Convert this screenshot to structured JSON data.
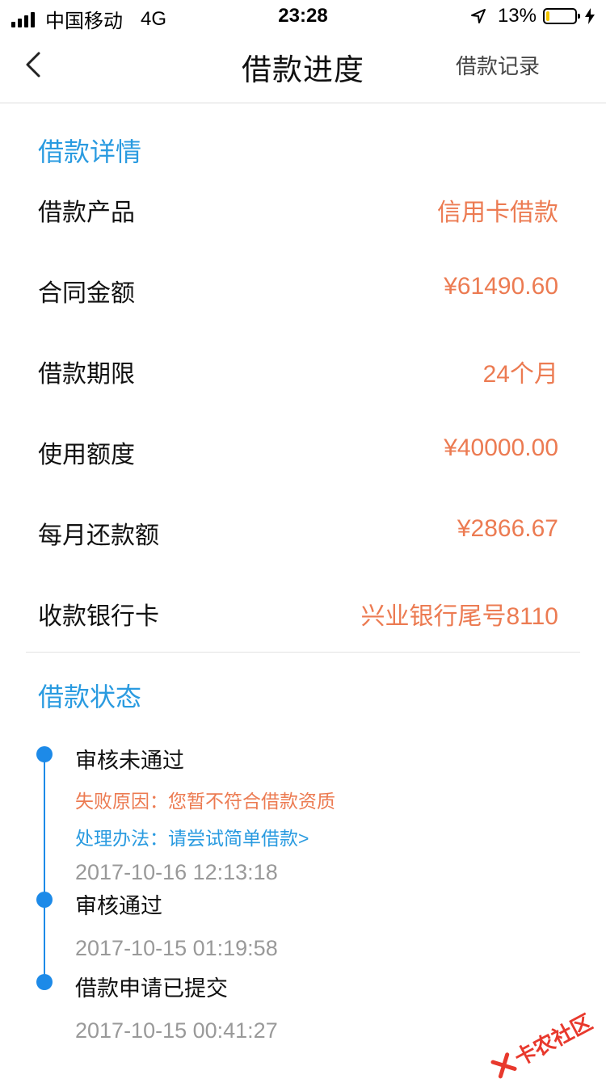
{
  "status_bar": {
    "carrier": "中国移动",
    "network": "4G",
    "time": "23:28",
    "battery_percent": "13%",
    "battery_level": 0.13
  },
  "nav": {
    "title": "借款进度",
    "record_link": "借款记录"
  },
  "details": {
    "section_title": "借款详情",
    "rows": [
      {
        "label": "借款产品",
        "value": "信用卡借款"
      },
      {
        "label": "合同金额",
        "value": "¥61490.60"
      },
      {
        "label": "借款期限",
        "value": "24个月"
      },
      {
        "label": "使用额度",
        "value": "¥40000.00"
      },
      {
        "label": "每月还款额",
        "value": "¥2866.67"
      },
      {
        "label": "收款银行卡",
        "value": "兴业银行尾号8110"
      }
    ]
  },
  "status": {
    "section_title": "借款状态",
    "timeline": [
      {
        "title": "审核未通过",
        "reason": "失败原因：您暂不符合借款资质",
        "action": "处理办法：请尝试简单借款>",
        "time": "2017-10-16 12:13:18"
      },
      {
        "title": "审核通过",
        "time": "2017-10-15 01:19:58"
      },
      {
        "title": "借款申请已提交",
        "time": "2017-10-15 00:41:27"
      }
    ]
  },
  "watermark": {
    "text": "卡农社区"
  },
  "colors": {
    "accent_blue": "#2a9be0",
    "timeline_blue": "#1d8ae8",
    "value_orange": "#ec7b52",
    "battery_yellow": "#f2c500"
  }
}
